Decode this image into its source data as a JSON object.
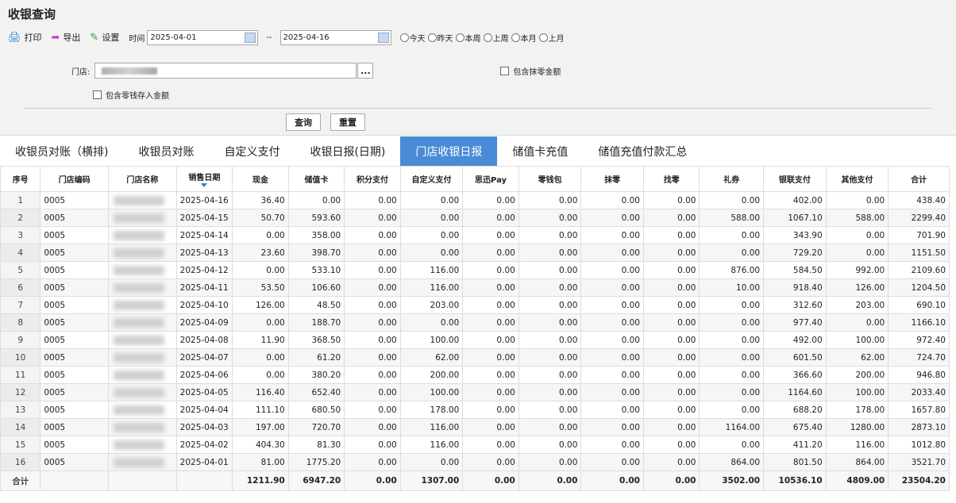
{
  "page_title": "收银查询",
  "toolbar": {
    "print": "打印",
    "export": "导出",
    "settings": "设置",
    "time_label": "时间",
    "date_from": "2025-04-01",
    "date_to": "2025-04-16",
    "range_sep": "--",
    "quick_ranges": [
      "今天",
      "昨天",
      "本周",
      "上周",
      "本月",
      "上月"
    ]
  },
  "filters": {
    "store_label": "门店:",
    "store_picker": "...",
    "include_rounding": "包含抹零金额",
    "include_change_deposit": "包含零钱存入金额"
  },
  "buttons": {
    "query": "查询",
    "reset": "重置"
  },
  "tabs": [
    "收银员对账（横排)",
    "收银员对账",
    "自定义支付",
    "收银日报(日期)",
    "门店收银日报",
    "储值卡充值",
    "储值充值付款汇总"
  ],
  "active_tab": 4,
  "table": {
    "columns": [
      "序号",
      "门店编码",
      "门店名称",
      "销售日期",
      "现金",
      "储值卡",
      "积分支付",
      "自定义支付",
      "思迅Pay",
      "零钱包",
      "抹零",
      "找零",
      "礼券",
      "银联支付",
      "其他支付",
      "合计"
    ],
    "rows": [
      [
        "1",
        "0005",
        "",
        "2025-04-16",
        "36.40",
        "0.00",
        "0.00",
        "0.00",
        "0.00",
        "0.00",
        "0.00",
        "0.00",
        "0.00",
        "402.00",
        "0.00",
        "438.40"
      ],
      [
        "2",
        "0005",
        "",
        "2025-04-15",
        "50.70",
        "593.60",
        "0.00",
        "0.00",
        "0.00",
        "0.00",
        "0.00",
        "0.00",
        "588.00",
        "1067.10",
        "588.00",
        "2299.40"
      ],
      [
        "3",
        "0005",
        "",
        "2025-04-14",
        "0.00",
        "358.00",
        "0.00",
        "0.00",
        "0.00",
        "0.00",
        "0.00",
        "0.00",
        "0.00",
        "343.90",
        "0.00",
        "701.90"
      ],
      [
        "4",
        "0005",
        "",
        "2025-04-13",
        "23.60",
        "398.70",
        "0.00",
        "0.00",
        "0.00",
        "0.00",
        "0.00",
        "0.00",
        "0.00",
        "729.20",
        "0.00",
        "1151.50"
      ],
      [
        "5",
        "0005",
        "",
        "2025-04-12",
        "0.00",
        "533.10",
        "0.00",
        "116.00",
        "0.00",
        "0.00",
        "0.00",
        "0.00",
        "876.00",
        "584.50",
        "992.00",
        "2109.60"
      ],
      [
        "6",
        "0005",
        "",
        "2025-04-11",
        "53.50",
        "106.60",
        "0.00",
        "116.00",
        "0.00",
        "0.00",
        "0.00",
        "0.00",
        "10.00",
        "918.40",
        "126.00",
        "1204.50"
      ],
      [
        "7",
        "0005",
        "",
        "2025-04-10",
        "126.00",
        "48.50",
        "0.00",
        "203.00",
        "0.00",
        "0.00",
        "0.00",
        "0.00",
        "0.00",
        "312.60",
        "203.00",
        "690.10"
      ],
      [
        "8",
        "0005",
        "",
        "2025-04-09",
        "0.00",
        "188.70",
        "0.00",
        "0.00",
        "0.00",
        "0.00",
        "0.00",
        "0.00",
        "0.00",
        "977.40",
        "0.00",
        "1166.10"
      ],
      [
        "9",
        "0005",
        "",
        "2025-04-08",
        "11.90",
        "368.50",
        "0.00",
        "100.00",
        "0.00",
        "0.00",
        "0.00",
        "0.00",
        "0.00",
        "492.00",
        "100.00",
        "972.40"
      ],
      [
        "10",
        "0005",
        "",
        "2025-04-07",
        "0.00",
        "61.20",
        "0.00",
        "62.00",
        "0.00",
        "0.00",
        "0.00",
        "0.00",
        "0.00",
        "601.50",
        "62.00",
        "724.70"
      ],
      [
        "11",
        "0005",
        "",
        "2025-04-06",
        "0.00",
        "380.20",
        "0.00",
        "200.00",
        "0.00",
        "0.00",
        "0.00",
        "0.00",
        "0.00",
        "366.60",
        "200.00",
        "946.80"
      ],
      [
        "12",
        "0005",
        "",
        "2025-04-05",
        "116.40",
        "652.40",
        "0.00",
        "100.00",
        "0.00",
        "0.00",
        "0.00",
        "0.00",
        "0.00",
        "1164.60",
        "100.00",
        "2033.40"
      ],
      [
        "13",
        "0005",
        "",
        "2025-04-04",
        "111.10",
        "680.50",
        "0.00",
        "178.00",
        "0.00",
        "0.00",
        "0.00",
        "0.00",
        "0.00",
        "688.20",
        "178.00",
        "1657.80"
      ],
      [
        "14",
        "0005",
        "",
        "2025-04-03",
        "197.00",
        "720.70",
        "0.00",
        "116.00",
        "0.00",
        "0.00",
        "0.00",
        "0.00",
        "1164.00",
        "675.40",
        "1280.00",
        "2873.10"
      ],
      [
        "15",
        "0005",
        "",
        "2025-04-02",
        "404.30",
        "81.30",
        "0.00",
        "116.00",
        "0.00",
        "0.00",
        "0.00",
        "0.00",
        "0.00",
        "411.20",
        "116.00",
        "1012.80"
      ],
      [
        "16",
        "0005",
        "",
        "2025-04-01",
        "81.00",
        "1775.20",
        "0.00",
        "0.00",
        "0.00",
        "0.00",
        "0.00",
        "0.00",
        "864.00",
        "801.50",
        "864.00",
        "3521.70"
      ]
    ],
    "total_label": "合计",
    "totals": [
      "",
      "",
      "",
      "1211.90",
      "6947.20",
      "0.00",
      "1307.00",
      "0.00",
      "0.00",
      "0.00",
      "0.00",
      "3502.00",
      "10536.10",
      "4809.00",
      "23504.20"
    ]
  }
}
